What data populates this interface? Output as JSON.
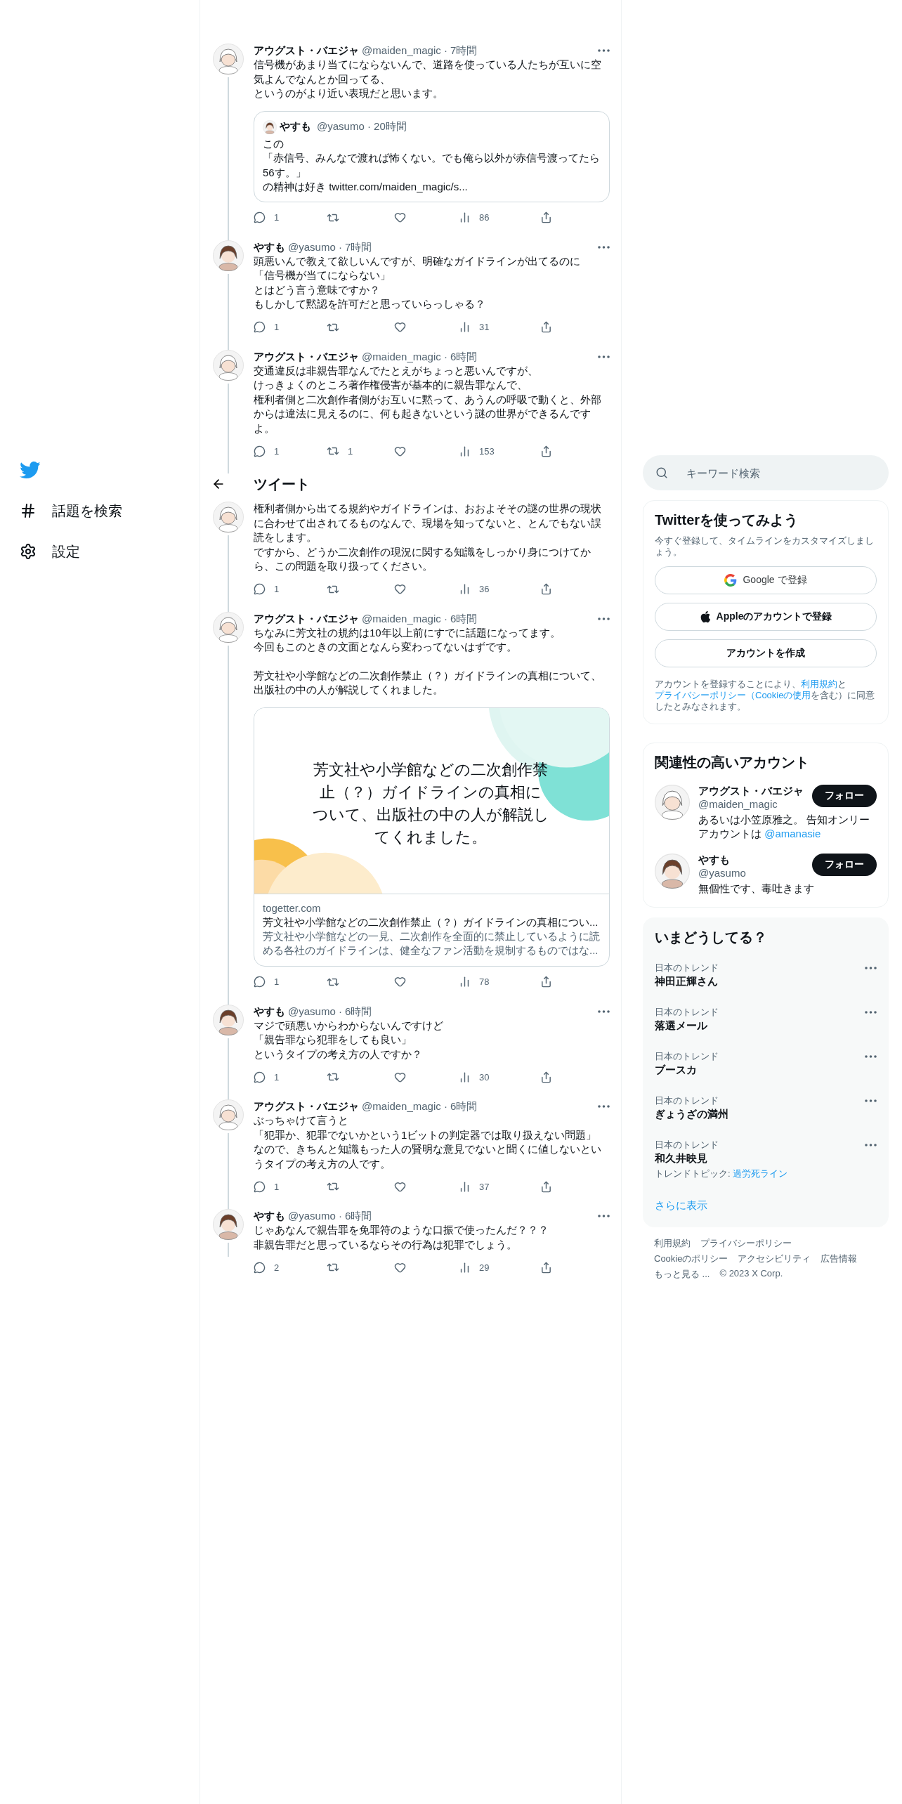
{
  "nav": {
    "items": [
      {
        "label": "話題を検索",
        "kind": "hashtag"
      },
      {
        "label": "設定",
        "kind": "settings"
      }
    ]
  },
  "header": {
    "title": "ツイート"
  },
  "tweets": [
    {
      "author": "アウグスト・バエジャ",
      "meta": "@maiden_magic · 7時間",
      "avatar": {
        "kind": "sketch"
      },
      "lines": [
        "信号機があまり当てにならないんで、道路を使っている人たちが互いに空気よんでなんとか回ってる、",
        "というのがより近い表現だと思います。"
      ],
      "quote": {
        "author": "やすも",
        "meta": "@yasumo · 20時間",
        "avatar": {
          "kind": "brown"
        },
        "lines": [
          "この",
          "「赤信号、みんなで渡れば怖くない。でも俺ら以外が赤信号渡ってたら56す。」",
          "の精神は好き twitter.com/maiden_magic/s..."
        ]
      },
      "stats": {
        "replies": "1",
        "views": "86"
      }
    },
    {
      "author": "やすも",
      "meta": "@yasumo · 7時間",
      "avatar": {
        "kind": "brown"
      },
      "lines": [
        "頭悪いんで教えて欲しいんですが、明確なガイドラインが出てるのに",
        "「信号機が当てにならない」",
        "とはどう言う意味ですか？",
        "もしかして黙認を許可だと思っていらっしゃる？"
      ],
      "stats": {
        "replies": "1",
        "views": "31"
      }
    },
    {
      "author": "アウグスト・バエジャ",
      "meta": "@maiden_magic · 6時間",
      "avatar": {
        "kind": "sketch"
      },
      "lines": [
        "交通違反は非親告罪なんでたとえがちょっと悪いんですが、",
        "けっきょくのところ著作権侵害が基本的に親告罪なんで、",
        "権利者側と二次創作者側がお互いに黙って、あうんの呼吸で動くと、外部からは違法に見えるのに、何も起きないという謎の世界ができるんですよ。"
      ],
      "stats": {
        "replies": "1",
        "retweets": "1",
        "views": "153"
      }
    },
    {
      "avatar": {
        "kind": "sketch"
      },
      "lines": [
        "権利者側から出てる規約やガイドラインは、おおよそその謎の世界の現状に合わせて出されてるものなんで、現場を知ってないと、とんでもない誤読をします。",
        "ですから、どうか二次創作の現況に関する知識をしっかり身につけてから、この問題を取り扱ってください。"
      ],
      "stats": {
        "replies": "1",
        "views": "36"
      }
    },
    {
      "author": "アウグスト・バエジャ",
      "meta": "@maiden_magic · 6時間",
      "avatar": {
        "kind": "sketch"
      },
      "lines": [
        "ちなみに芳文社の規約は10年以上前にすでに話題になってます。",
        "今回もこのときの文面となんら変わってないはずです。"
      ],
      "lines2": [
        "芳文社や小学館などの二次創作禁止（？）ガイドラインの真相について、出版社の中の人が解説してくれました。"
      ],
      "card": {
        "image_text": "芳文社や小学館などの二次創作禁止（？）ガイドラインの真相について、出版社の中の人が解説してくれました。",
        "domain": "togetter.com",
        "title": "芳文社や小学館などの二次創作禁止（？）ガイドラインの真相につい...",
        "description": "芳文社や小学館などの一見、二次創作を全面的に禁止しているように読める各社のガイドラインは、健全なファン活動を規制するものではな..."
      },
      "stats": {
        "replies": "1",
        "views": "78"
      }
    },
    {
      "author": "やすも",
      "meta": "@yasumo · 6時間",
      "avatar": {
        "kind": "brown"
      },
      "lines": [
        "マジで頭悪いからわからないんですけど",
        "「親告罪なら犯罪をしても良い」",
        "というタイプの考え方の人ですか？"
      ],
      "stats": {
        "replies": "1",
        "views": "30"
      }
    },
    {
      "author": "アウグスト・バエジャ",
      "meta": "@maiden_magic · 6時間",
      "avatar": {
        "kind": "sketch"
      },
      "lines": [
        "ぶっちゃけて言うと",
        "「犯罪か、犯罪でないかという1ビットの判定器では取り扱えない問題」",
        "なので、きちんと知識もった人の賢明な意見でないと聞くに値しないというタイプの考え方の人です。"
      ],
      "stats": {
        "replies": "1",
        "views": "37"
      }
    },
    {
      "author": "やすも",
      "meta": "@yasumo · 6時間",
      "avatar": {
        "kind": "brown"
      },
      "lines": [
        "じゃあなんで親告罪を免罪符のような口振で使ったんだ？？？",
        "非親告罪だと思っているならその行為は犯罪でしょう。"
      ],
      "stats": {
        "replies": "2",
        "views": "29"
      }
    }
  ],
  "sidebar": {
    "search": {
      "placeholder": "キーワード検索"
    },
    "signup": {
      "title": "Twitterを使ってみよう",
      "subtitle": "今すぐ登録して、タイムラインをカスタマイズしましょう。",
      "buttons": [
        {
          "label": "Google で登録",
          "kind": "google"
        },
        {
          "label": "Appleのアカウントで登録",
          "kind": "apple"
        },
        {
          "label": "アカウントを作成",
          "kind": "plain"
        }
      ],
      "legal": [
        {
          "text": "アカウントを登録することにより、",
          "link": false
        },
        {
          "text": "利用規約",
          "link": true
        },
        {
          "text": "と",
          "link": false
        },
        {
          "text": "プライバシーポリシー（Cookieの使用",
          "link": true
        },
        {
          "text": "を含む）に同意したとみなされます。",
          "link": false
        }
      ]
    },
    "follow": {
      "title": "関連性の高いアカウント",
      "accounts": [
        {
          "name": "アウグスト・バエジャ",
          "handle": "@maiden_magic",
          "avatar": {
            "kind": "sketch"
          },
          "button": "フォロー",
          "bio": [
            {
              "text": "あるいは小笠原雅之。 告知オンリーアカウントは ",
              "link": false
            },
            {
              "text": "@amanasie",
              "link": true
            }
          ]
        },
        {
          "name": "やすも",
          "handle": "@yasumo",
          "avatar": {
            "kind": "brown"
          },
          "button": "フォロー",
          "bio": [
            {
              "text": "無個性です、毒吐きます",
              "link": false
            }
          ]
        }
      ]
    },
    "trends": {
      "title": "いまどうしてる？",
      "items": [
        {
          "context": "日本のトレンド",
          "name": "神田正輝さん"
        },
        {
          "context": "日本のトレンド",
          "name": "落選メール"
        },
        {
          "context": "日本のトレンド",
          "name": "ブースカ"
        },
        {
          "context": "日本のトレンド",
          "name": "ぎょうざの満州"
        },
        {
          "context": "日本のトレンド",
          "name": "和久井映見",
          "topic_label": "トレンドトピック: ",
          "topic_link": "過労死ライン"
        }
      ],
      "more": "さらに表示"
    },
    "footer": {
      "links": [
        "利用規約",
        "プライバシーポリシー",
        "Cookieのポリシー",
        "アクセシビリティ",
        "広告情報",
        "もっと見る ..."
      ],
      "copyright": "© 2023 X Corp."
    }
  }
}
